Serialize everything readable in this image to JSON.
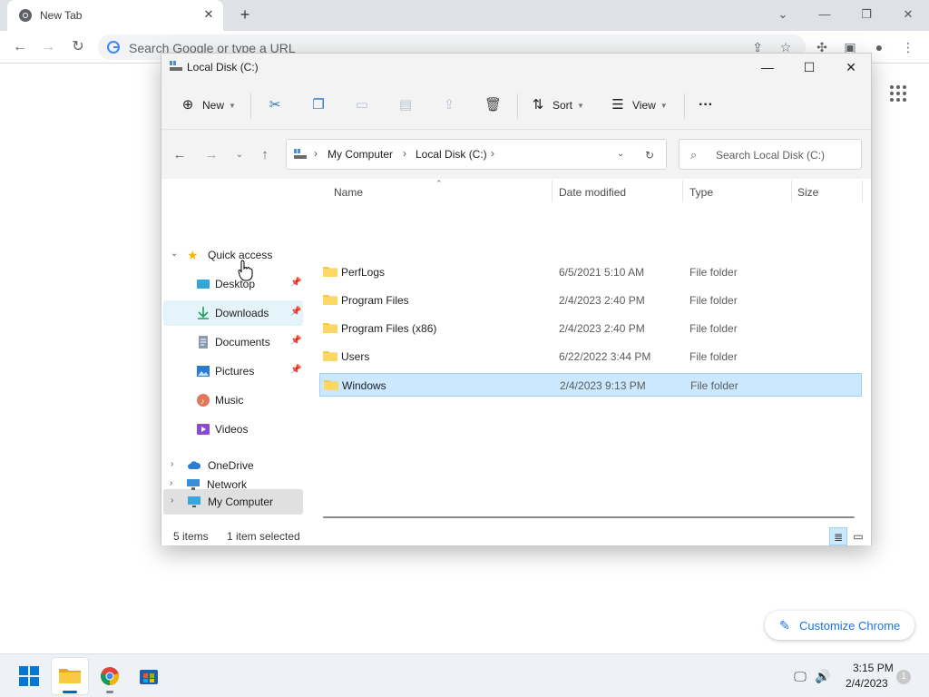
{
  "browser": {
    "tab_title": "New Tab",
    "new_tab_symbol": "+",
    "omnibox_placeholder": "Search Google or type a URL",
    "customize_label": "Customize Chrome"
  },
  "explorer": {
    "window_title": "Local Disk (C:)",
    "commands": {
      "new_label": "New",
      "sort_label": "Sort",
      "view_label": "View",
      "more_label": "···"
    },
    "breadcrumbs": [
      "My Computer",
      "Local Disk (C:)"
    ],
    "search_placeholder": "Search Local Disk (C:)",
    "nav": {
      "quick_access": "Quick access",
      "items": [
        {
          "label": "Desktop",
          "icon": "desktop-icon",
          "pinned": true
        },
        {
          "label": "Downloads",
          "icon": "downloads-icon",
          "pinned": true
        },
        {
          "label": "Documents",
          "icon": "documents-icon",
          "pinned": true
        },
        {
          "label": "Pictures",
          "icon": "pictures-icon",
          "pinned": true
        },
        {
          "label": "Music",
          "icon": "music-icon",
          "pinned": false
        },
        {
          "label": "Videos",
          "icon": "videos-icon",
          "pinned": false
        }
      ],
      "onedrive": "OneDrive",
      "my_computer": "My Computer",
      "network": "Network"
    },
    "columns": [
      "Name",
      "Date modified",
      "Type",
      "Size"
    ],
    "files": [
      {
        "name": "PerfLogs",
        "date": "6/5/2021 5:10 AM",
        "type": "File folder"
      },
      {
        "name": "Program Files",
        "date": "2/4/2023 2:40 PM",
        "type": "File folder"
      },
      {
        "name": "Program Files (x86)",
        "date": "2/4/2023 2:40 PM",
        "type": "File folder"
      },
      {
        "name": "Users",
        "date": "6/22/2022 3:44 PM",
        "type": "File folder"
      },
      {
        "name": "Windows",
        "date": "2/4/2023 9:13 PM",
        "type": "File folder",
        "selected": true
      }
    ],
    "status": {
      "item_count": "5 items",
      "selection": "1 item selected"
    }
  },
  "taskbar": {
    "time": "3:15 PM",
    "date": "2/4/2023",
    "notification_count": "1"
  },
  "colors": {
    "accent": "#0067c0",
    "selection_fill": "#cce8ff",
    "chrome_link": "#1a73e8",
    "folder_yellow": "#f8c945"
  }
}
